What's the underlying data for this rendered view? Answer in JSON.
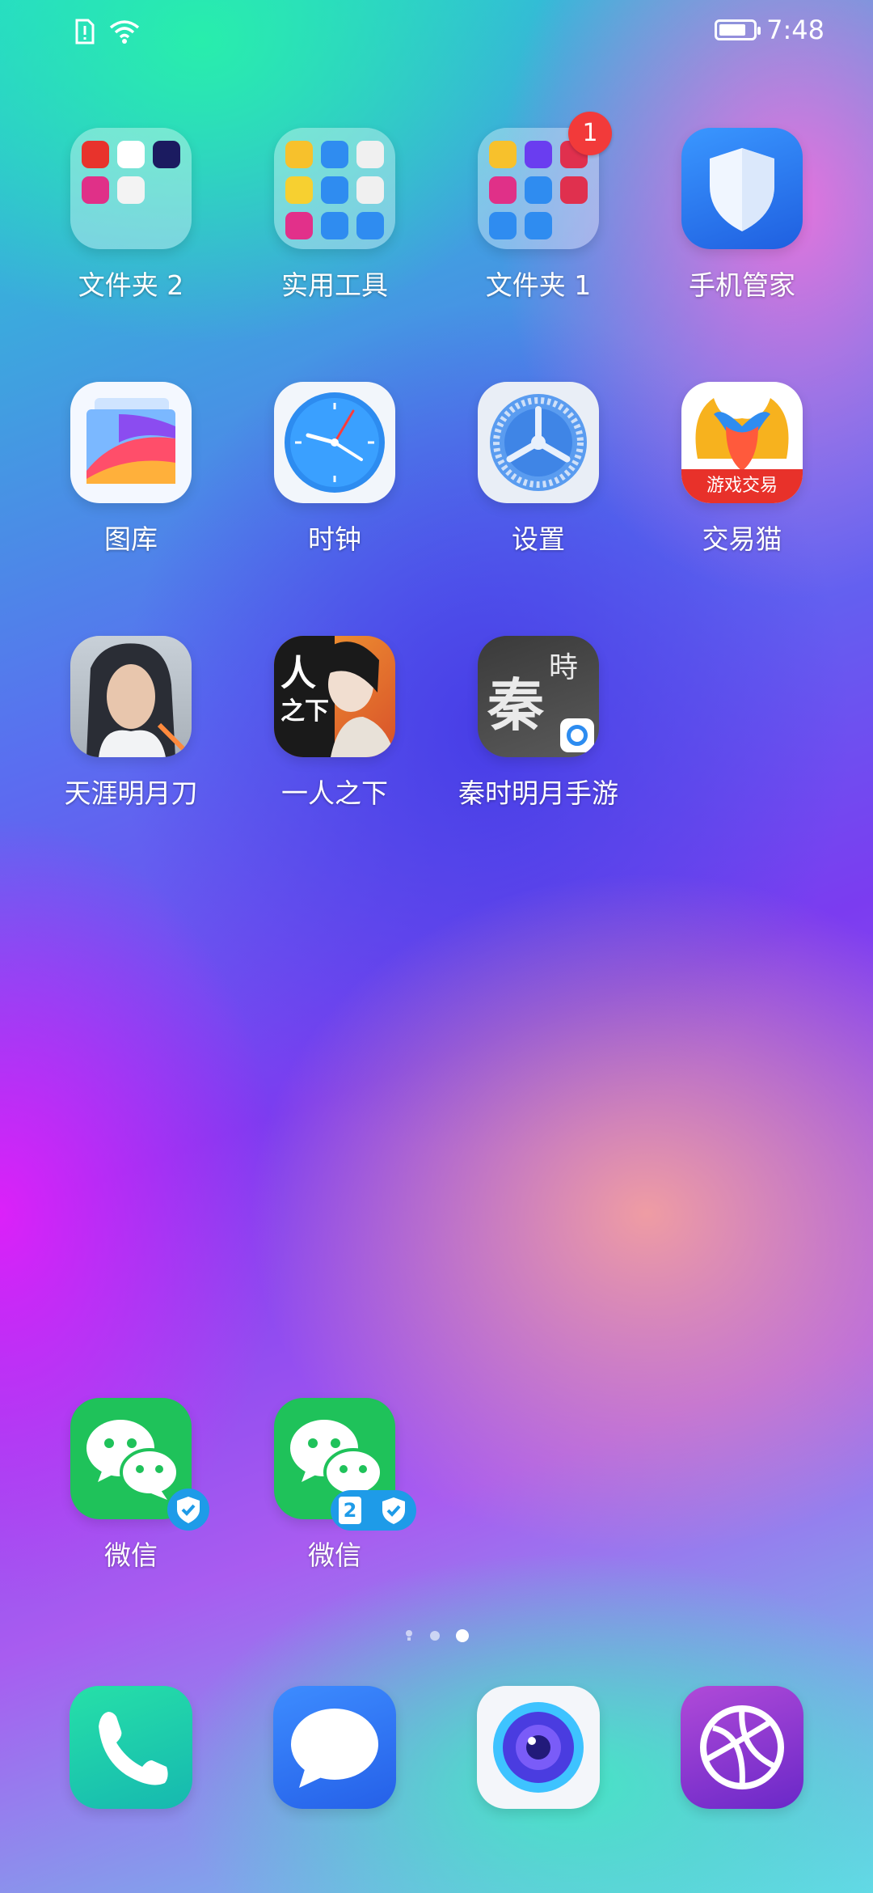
{
  "status_bar": {
    "time": "7:48",
    "icons": [
      "sim-alert-icon",
      "wifi-icon",
      "battery-icon"
    ],
    "battery_level": 0.8
  },
  "home": {
    "apps": [
      {
        "label": "文件夹 2",
        "icon": "folder-icon"
      },
      {
        "label": "实用工具",
        "icon": "folder-icon"
      },
      {
        "label": "文件夹 1",
        "icon": "folder-icon",
        "badge": "1"
      },
      {
        "label": "手机管家",
        "icon": "shield-icon"
      },
      {
        "label": "图库",
        "icon": "gallery-icon"
      },
      {
        "label": "时钟",
        "icon": "clock-icon"
      },
      {
        "label": "设置",
        "icon": "gear-icon"
      },
      {
        "label": "交易猫",
        "icon": "cat-icon"
      },
      {
        "label": "天涯明月刀",
        "icon": "game-icon"
      },
      {
        "label": "一人之下",
        "icon": "game-icon"
      },
      {
        "label": "秦时明月手游",
        "icon": "game-icon"
      },
      {
        "label": "微信",
        "icon": "wechat-icon"
      },
      {
        "label": "微信",
        "icon": "wechat-icon"
      }
    ]
  },
  "page_indicator": {
    "pages": 3,
    "current": 3
  },
  "dock": [
    {
      "name": "phone",
      "icon": "phone-icon"
    },
    {
      "name": "messages",
      "icon": "message-icon"
    },
    {
      "name": "camera",
      "icon": "camera-icon"
    },
    {
      "name": "browser",
      "icon": "browser-icon"
    }
  ],
  "icon_text": {
    "jiaoyimao_banner": "游戏交易",
    "qin_char1": "秦",
    "qin_char2": "時",
    "yiren_char1": "人",
    "yiren_char2": "之下",
    "wechat2_clone_num": "2"
  },
  "colors": {
    "badge": "#f23a3a",
    "wechat": "#1fc25a",
    "shield": "#2a7bf0"
  }
}
